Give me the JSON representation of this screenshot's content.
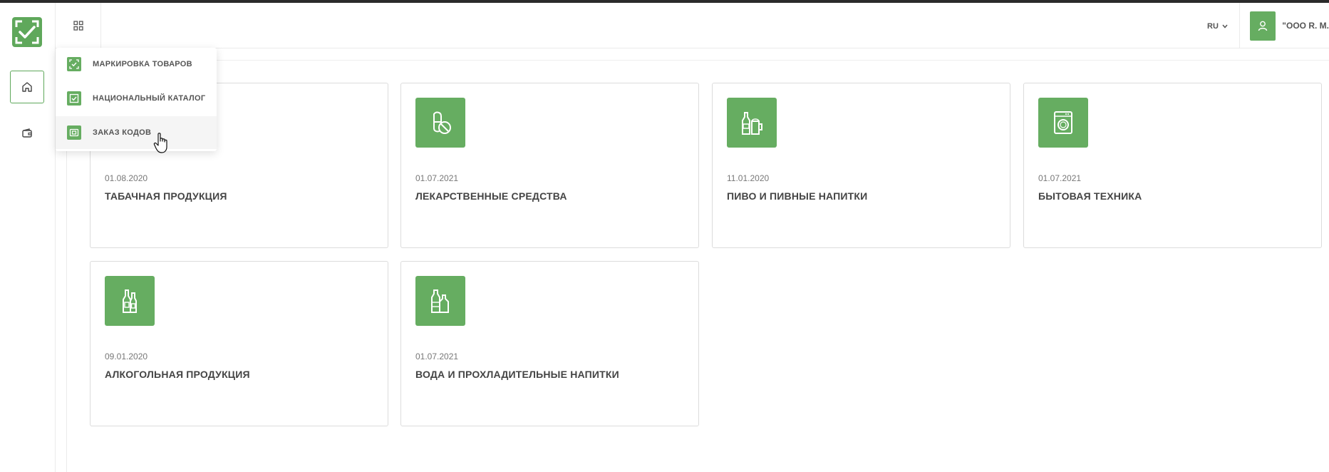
{
  "header": {
    "lang": "RU",
    "user_name": "\"ООО R. M."
  },
  "dropdown": {
    "items": [
      {
        "label": "МАРКИРОВКА ТОВАРОВ",
        "icon": "marking-icon"
      },
      {
        "label": "НАЦИОНАЛЬНЫЙ КАТАЛОГ",
        "icon": "catalog-icon"
      },
      {
        "label": "ЗАКАЗ КОДОВ",
        "icon": "code-order-icon"
      }
    ]
  },
  "cards": [
    {
      "date": "01.08.2020",
      "title": "ТАБАЧНАЯ ПРОДУКЦИЯ",
      "icon": "tobacco-icon"
    },
    {
      "date": "01.07.2021",
      "title": "ЛЕКАРСТВЕННЫЕ СРЕДСТВА",
      "icon": "pill-icon"
    },
    {
      "date": "11.01.2020",
      "title": "ПИВО И ПИВНЫЕ НАПИТКИ",
      "icon": "beer-icon"
    },
    {
      "date": "01.07.2021",
      "title": "БЫТОВАЯ ТЕХНИКА",
      "icon": "washing-machine-icon"
    },
    {
      "date": "09.01.2020",
      "title": "АЛКОГОЛЬНАЯ ПРОДУКЦИЯ",
      "icon": "bottles-icon"
    },
    {
      "date": "01.07.2021",
      "title": "ВОДА И ПРОХЛАДИТЕЛЬНЫЕ НАПИТКИ",
      "icon": "water-icon"
    }
  ],
  "colors": {
    "accent": "#66ad61",
    "border": "#dcdcdc"
  }
}
